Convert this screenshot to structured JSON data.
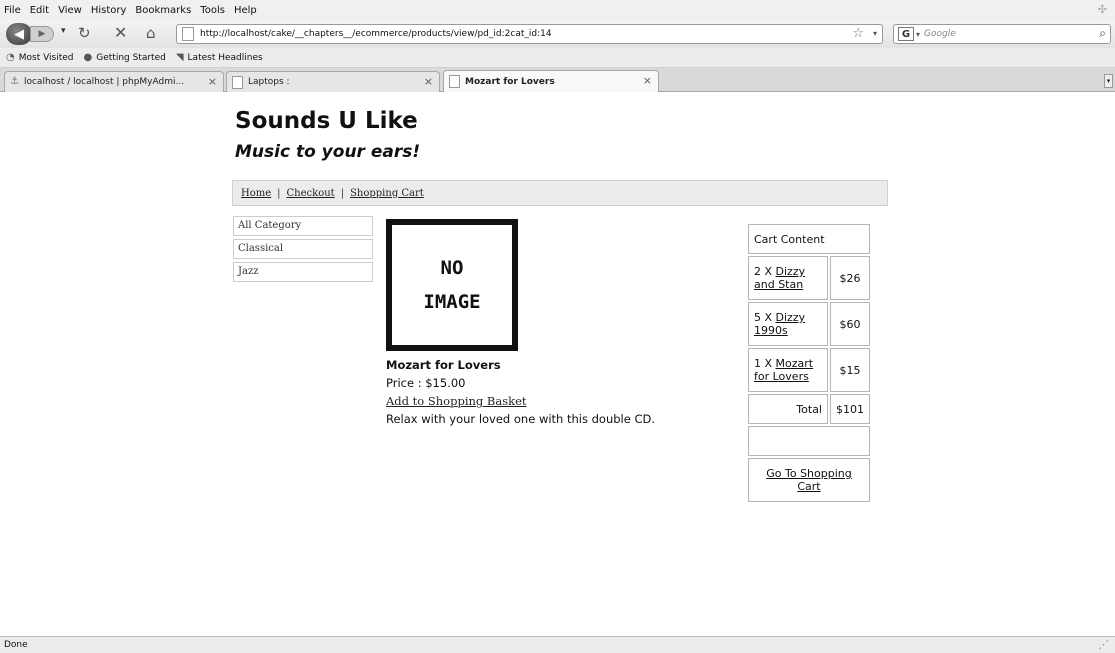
{
  "browser": {
    "menu": [
      "File",
      "Edit",
      "View",
      "History",
      "Bookmarks",
      "Tools",
      "Help"
    ],
    "url": "http://localhost/cake/__chapters__/ecommerce/products/view/pd_id:2cat_id:14",
    "search_placeholder": "Google",
    "bookmarks": [
      {
        "label": "Most Visited",
        "icon": "clock-icon"
      },
      {
        "label": "Getting Started",
        "icon": "firefox-icon"
      },
      {
        "label": "Latest Headlines",
        "icon": "rss-icon"
      }
    ],
    "tabs": [
      {
        "label": "localhost / localhost | phpMyAdmi...",
        "active": false
      },
      {
        "label": "Laptops :",
        "active": false
      },
      {
        "label": "Mozart for Lovers",
        "active": true
      }
    ],
    "status": "Done"
  },
  "site": {
    "title": "Sounds U Like",
    "tagline": "Music to your ears!"
  },
  "nav": {
    "home": "Home",
    "checkout": "Checkout",
    "cart": "Shopping Cart",
    "separator": "|"
  },
  "categories": [
    "All Category",
    "Classical",
    "Jazz"
  ],
  "product": {
    "image_line1": "NO",
    "image_line2": "IMAGE",
    "name": "Mozart for Lovers",
    "price": "Price : $15.00",
    "add_link": "Add to Shopping Basket",
    "description": "Relax with your loved one with this double CD."
  },
  "cart": {
    "header": "Cart Content",
    "items": [
      {
        "qty": "2 X",
        "name": "Dizzy and Stan",
        "amount": "$26"
      },
      {
        "qty": "5 X",
        "name": "Dizzy 1990s",
        "amount": "$60"
      },
      {
        "qty": "1 X",
        "name": "Mozart for Lovers",
        "amount": "$15"
      }
    ],
    "total_label": "Total",
    "total": "$101",
    "go_link": "Go To Shopping Cart"
  }
}
